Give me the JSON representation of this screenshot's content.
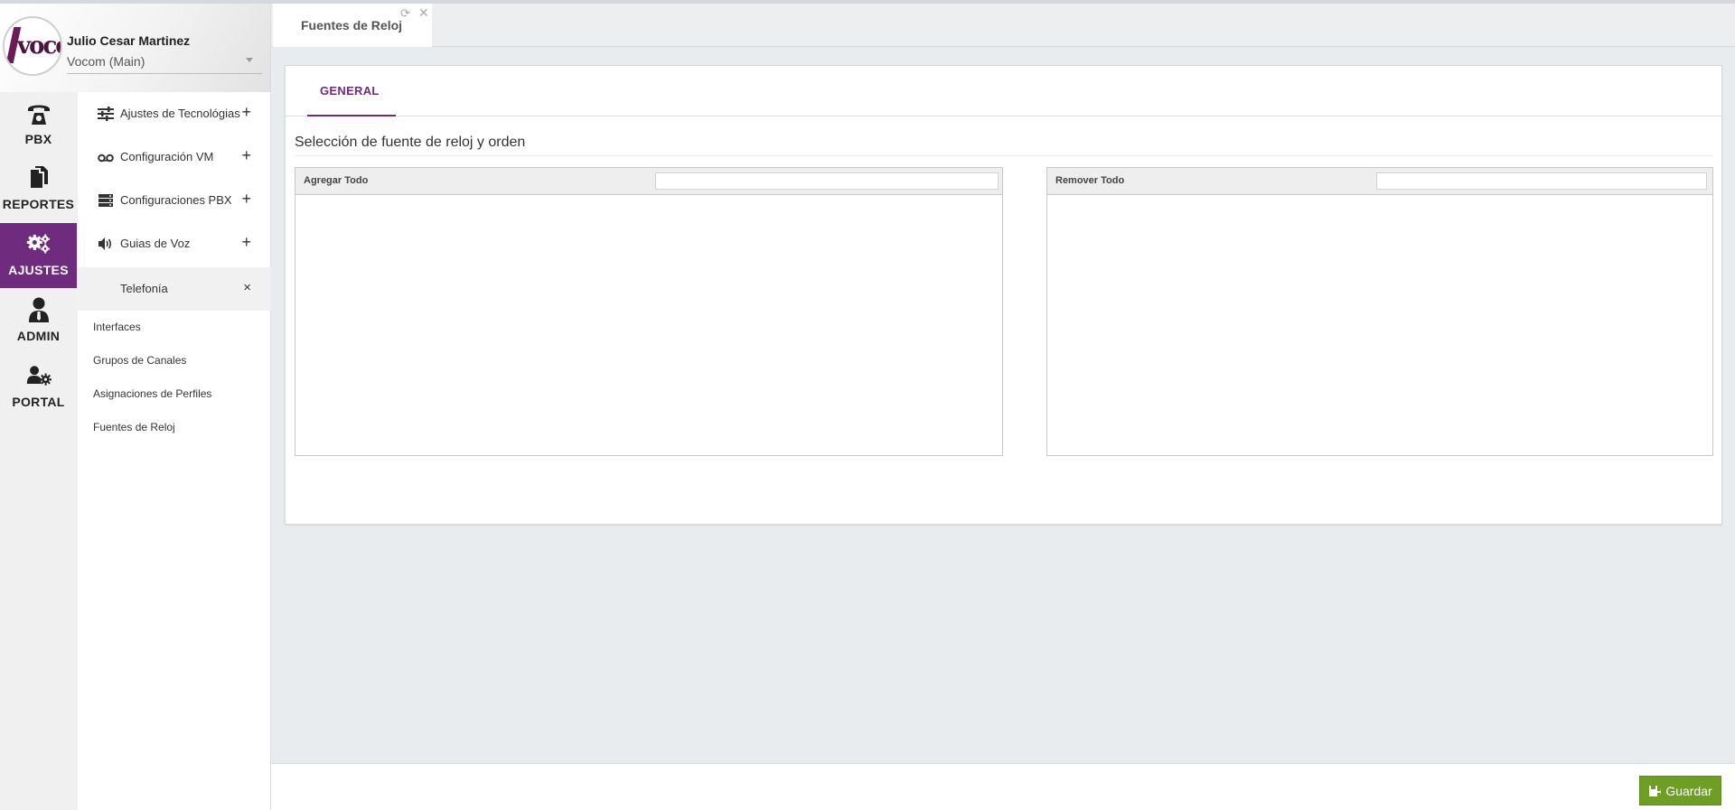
{
  "user": {
    "name": "Julio Cesar Martinez",
    "company": "Vocom (Main)",
    "logo_text": "vocom"
  },
  "rail": [
    {
      "label": "PBX",
      "icon": "phone-icon",
      "active": false
    },
    {
      "label": "REPORTES",
      "icon": "documents-icon",
      "active": false
    },
    {
      "label": "AJUSTES",
      "icon": "gears-icon",
      "active": true
    },
    {
      "label": "ADMIN",
      "icon": "admin-user-icon",
      "active": false
    },
    {
      "label": "PORTAL",
      "icon": "user-gear-icon",
      "active": false
    }
  ],
  "menu": {
    "items": [
      {
        "label": "Ajustes de Tecnológias",
        "icon": "sliders-icon",
        "toggle": "+"
      },
      {
        "label": "Configuración VM",
        "icon": "voicemail-icon",
        "toggle": "+"
      },
      {
        "label": "Configuraciones PBX",
        "icon": "server-icon",
        "toggle": "+"
      },
      {
        "label": "Guias de Voz",
        "icon": "volume-icon",
        "toggle": "+"
      },
      {
        "label": "Telefonía",
        "icon": "",
        "toggle": "×"
      }
    ],
    "subitems": [
      {
        "label": "Interfaces"
      },
      {
        "label": "Grupos de Canales"
      },
      {
        "label": "Asignaciones de Perfiles"
      },
      {
        "label": "Fuentes de Reloj"
      }
    ]
  },
  "tabs": {
    "active_label": "Fuentes de Reloj",
    "refresh_icon": "refresh-icon",
    "close_icon": "close-icon"
  },
  "panel": {
    "tab_label": "GENERAL",
    "section_title": "Selección de fuente de reloj y orden",
    "left_list": {
      "action": "Agregar Todo",
      "filter_value": ""
    },
    "right_list": {
      "action": "Remover Todo",
      "filter_value": ""
    }
  },
  "footer": {
    "save_label": "Guardar",
    "save_color": "#6e9e23"
  },
  "colors": {
    "accent": "#6f2b7e",
    "background": "#e9ecef"
  }
}
